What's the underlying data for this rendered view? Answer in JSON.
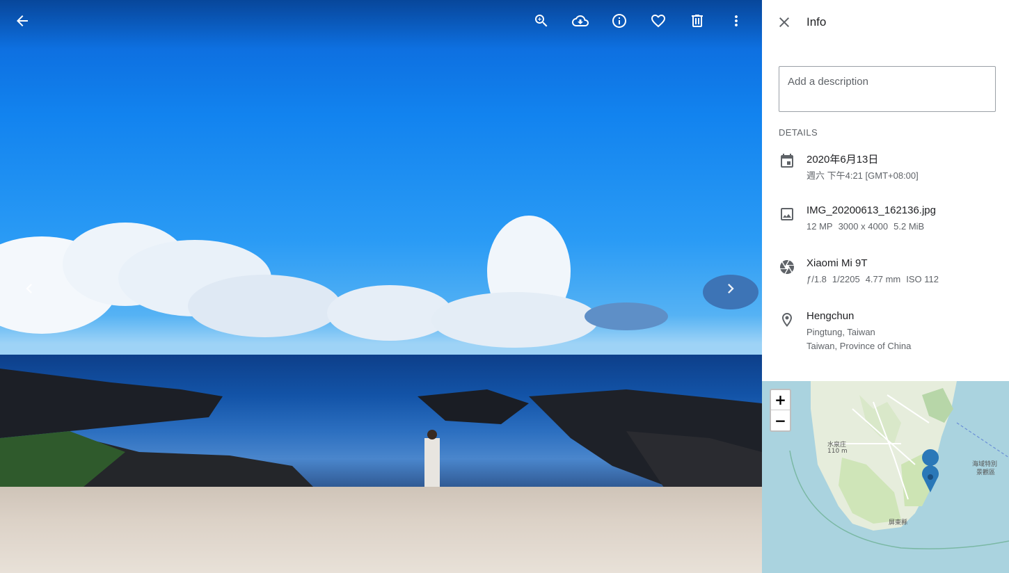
{
  "toolbar": {
    "back_icon": "arrow-left-icon",
    "actions": [
      "zoom-in-icon",
      "cloud-download-icon",
      "info-icon",
      "heart-icon",
      "trash-icon",
      "more-vert-icon"
    ]
  },
  "panel": {
    "title": "Info",
    "description_placeholder": "Add a description",
    "details_heading": "DETAILS",
    "date": {
      "primary": "2020年6月13日",
      "secondary": "週六 下午4:21 [GMT+08:00]"
    },
    "file": {
      "primary": "IMG_20200613_162136.jpg",
      "mp": "12 MP",
      "dimensions": "3000 x 4000",
      "size": "5.2 MiB"
    },
    "camera": {
      "primary": "Xiaomi Mi 9T",
      "aperture": "ƒ/1.8",
      "shutter": "1/2205",
      "focal": "4.77 mm",
      "iso": "ISO 112"
    },
    "location": {
      "primary": "Hengchun",
      "line2": "Pingtung, Taiwan",
      "line3": "Taiwan, Province of China"
    }
  },
  "map": {
    "zoom_in": "+",
    "zoom_out": "−",
    "label_peak": "水泉庄",
    "label_elev": "110 m",
    "label_zone": "海域特別",
    "label_zone2": "景觀區",
    "label_county": "屏東縣"
  }
}
